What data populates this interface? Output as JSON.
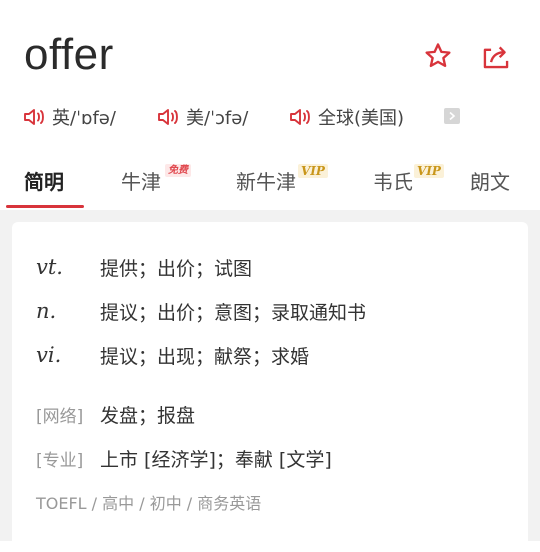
{
  "word": "offer",
  "header_icons": [
    "star-icon",
    "share-icon"
  ],
  "pronunciations": [
    {
      "label": "英/ˈɒfə/",
      "icon": "speaker-icon"
    },
    {
      "label": "美/ˈɔfə/",
      "icon": "speaker-icon"
    },
    {
      "label": "全球(美国)",
      "icon": "speaker-icon"
    }
  ],
  "tabs": [
    {
      "label": "简明",
      "active": true
    },
    {
      "label": "牛津",
      "badge": "免费"
    },
    {
      "label": "新牛津",
      "badge": "VIP"
    },
    {
      "label": "韦氏",
      "badge": "VIP"
    },
    {
      "label": "朗文"
    }
  ],
  "definitions": [
    {
      "pos": "vt.",
      "meaning": "提供；出价；试图"
    },
    {
      "pos": "n.",
      "meaning": "提议；出价；意图；录取通知书"
    },
    {
      "pos": "vi.",
      "meaning": "提议；出现；献祭；求婚"
    }
  ],
  "extra": [
    {
      "tag": "[网络]",
      "meaning": "发盘；报盘"
    },
    {
      "tag": "[专业]",
      "meaning": "上市 [经济学]；奉献 [文学]"
    }
  ],
  "levels": "TOEFL / 高中 / 初中 / 商务英语",
  "colors": {
    "accent": "#d8343b",
    "vip": "#c9961a",
    "muted": "#999999",
    "background": "#f2f2f2"
  }
}
